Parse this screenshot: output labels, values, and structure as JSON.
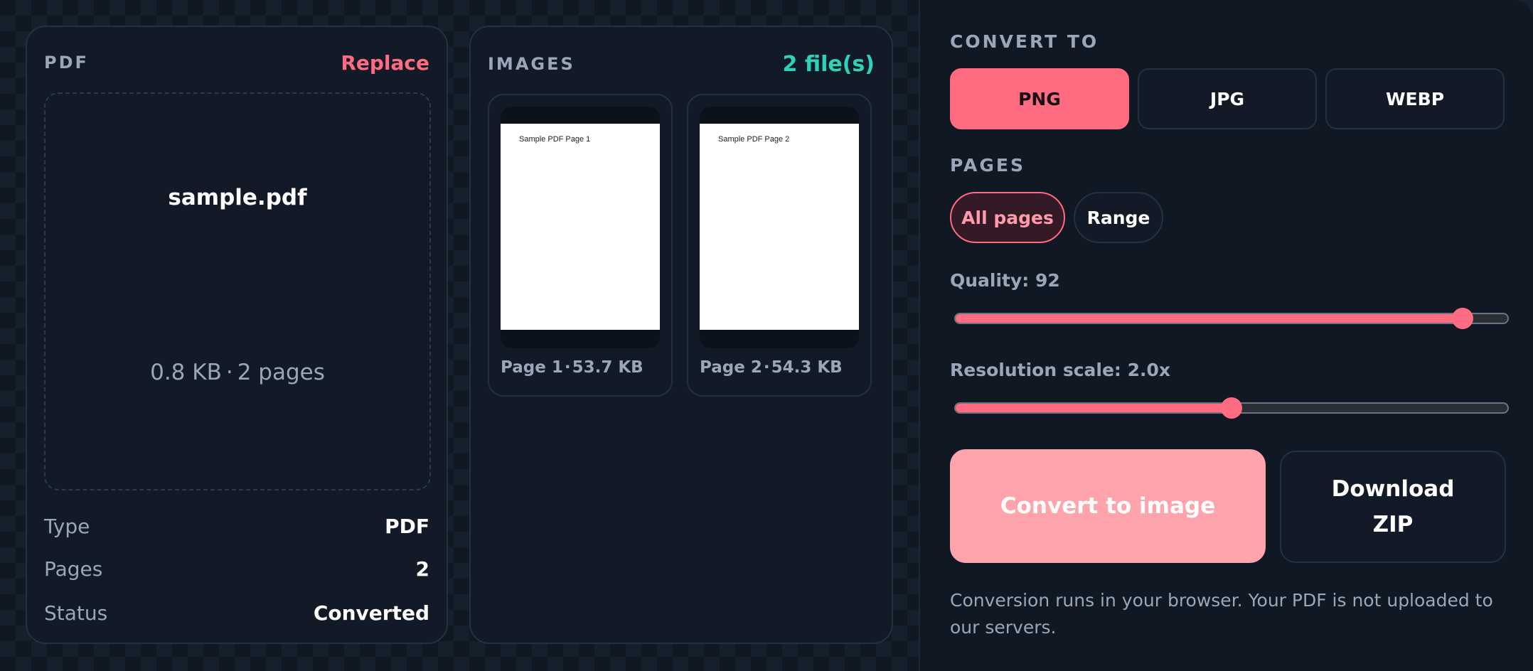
{
  "pdf_card": {
    "title": "PDF",
    "replace_label": "Replace",
    "file_name": "sample.pdf",
    "file_size": "0.8 KB",
    "page_count_text": "2 pages",
    "separator": "·",
    "info": [
      {
        "label": "Type",
        "value": "PDF"
      },
      {
        "label": "Pages",
        "value": "2"
      },
      {
        "label": "Status",
        "value": "Converted"
      }
    ]
  },
  "images_card": {
    "title": "IMAGES",
    "count": "2 file(s)",
    "separator": "·",
    "items": [
      {
        "page_text": "Sample PDF Page 1",
        "label": "Page 1",
        "size": "53.7 KB"
      },
      {
        "page_text": "Sample PDF Page 2",
        "label": "Page 2",
        "size": "54.3 KB"
      }
    ]
  },
  "settings": {
    "convert_to_label": "CONVERT TO",
    "formats": [
      {
        "label": "PNG",
        "selected": true
      },
      {
        "label": "JPG",
        "selected": false
      },
      {
        "label": "WEBP",
        "selected": false
      }
    ],
    "pages_label": "PAGES",
    "page_modes": [
      {
        "label": "All pages",
        "selected": true
      },
      {
        "label": "Range",
        "selected": false
      }
    ],
    "quality": {
      "label": "Quality: 92",
      "value": 92,
      "min": 1,
      "max": 100
    },
    "resolution": {
      "label": "Resolution scale: 2.0x",
      "value": 2.0,
      "min": 0.5,
      "max": 3.5
    },
    "convert_button": "Convert to image",
    "download_button": "Download ZIP",
    "note": "Conversion runs in your browser. Your PDF is not uploaded to our servers."
  },
  "colors": {
    "accent": "#ff6b81",
    "accent_light": "#ffa3ad",
    "teal": "#2ed3b7",
    "muted_text": "#9aa7b8",
    "card_bg": "#111a26"
  }
}
